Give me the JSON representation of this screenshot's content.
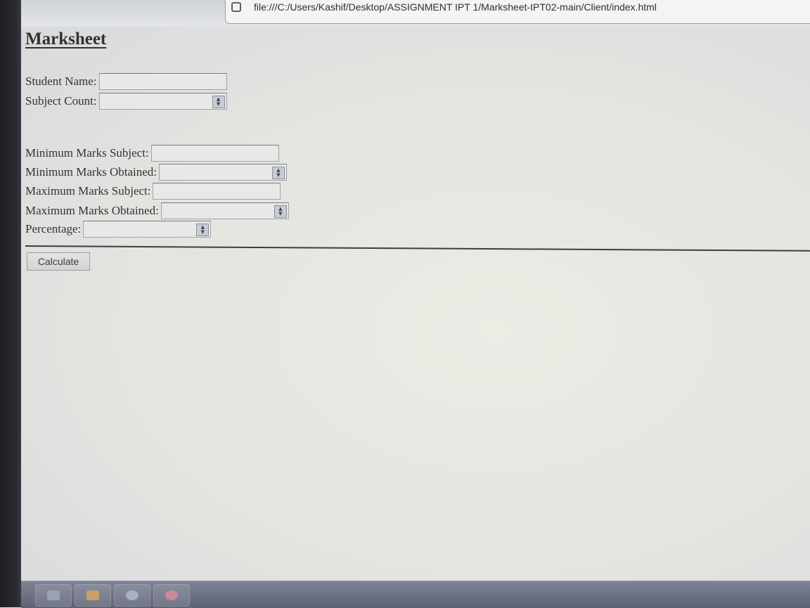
{
  "browser": {
    "url": "file:///C:/Users/Kashif/Desktop/ASSIGNMENT IPT 1/Marksheet-IPT02-main/Client/index.html"
  },
  "page": {
    "title": "Marksheet",
    "fields": {
      "student_name": {
        "label": "Student Name:",
        "value": ""
      },
      "subject_count": {
        "label": "Subject Count:",
        "value": ""
      },
      "min_marks_subject": {
        "label": "Minimum Marks Subject:",
        "value": ""
      },
      "min_marks_obtained": {
        "label": "Minimum Marks Obtained:",
        "value": ""
      },
      "max_marks_subject": {
        "label": "Maximum Marks Subject:",
        "value": ""
      },
      "max_marks_obtained": {
        "label": "Maximum Marks Obtained:",
        "value": ""
      },
      "percentage": {
        "label": "Percentage:",
        "value": ""
      }
    },
    "calculate_label": "Calculate"
  },
  "taskbar": {
    "icons": [
      "file-explorer-icon",
      "media-player-icon",
      "browser-icon",
      "paint-icon"
    ]
  }
}
